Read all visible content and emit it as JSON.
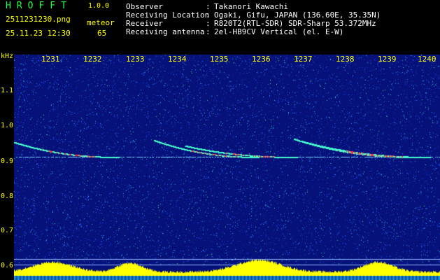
{
  "header": {
    "app_title": "HROFFT",
    "version": "1.0.0",
    "filename": "2511231230.png",
    "datetime": "25.11.23 12:30",
    "meteor_label": "meteor",
    "meteor_count": "65"
  },
  "info": [
    {
      "label": "Observer",
      "value": "Takanori Kawachi"
    },
    {
      "label": "Receiving Location",
      "value": "Ogaki, Gifu, JAPAN (136.60E, 35.35N)"
    },
    {
      "label": "Receiver",
      "value": "R820T2(RTL-SDR) SDR-Sharp 53.372MHz"
    },
    {
      "label": "Receiving antenna",
      "value": "2el-HB9CV Vertical (el. E-W)"
    }
  ],
  "info_separator": ":",
  "axis": {
    "y_unit": "kHz",
    "y_ticks": [
      "1.1",
      "1.0",
      "0.9",
      "0.8",
      "0.7",
      "0.6"
    ],
    "x_ticks": [
      "1231",
      "1232",
      "1233",
      "1234",
      "1235",
      "1236",
      "1237",
      "1238",
      "1239",
      "1240"
    ]
  },
  "colors": {
    "background": "#000000",
    "plot_background": "#06127a",
    "header_green": "#22ff44",
    "header_yellow": "#ffff00",
    "carrier_line": "#7fd8ff",
    "meteor_trace": "#44ffcc",
    "meteor_core": "#ff3344",
    "power_fill": "#ffff00",
    "power_base": "#00ccff"
  }
}
